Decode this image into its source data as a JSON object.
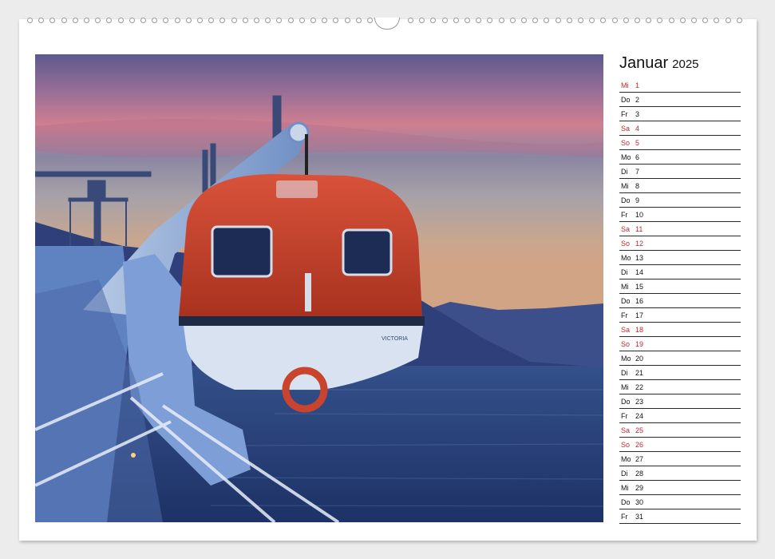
{
  "calendar": {
    "month": "Januar",
    "year": "2025",
    "weekend_color": "#c2272d",
    "days": [
      {
        "wd": "Mi",
        "d": "1",
        "red": true
      },
      {
        "wd": "Do",
        "d": "2",
        "red": false
      },
      {
        "wd": "Fr",
        "d": "3",
        "red": false
      },
      {
        "wd": "Sa",
        "d": "4",
        "red": true
      },
      {
        "wd": "So",
        "d": "5",
        "red": true
      },
      {
        "wd": "Mo",
        "d": "6",
        "red": false
      },
      {
        "wd": "Di",
        "d": "7",
        "red": false
      },
      {
        "wd": "Mi",
        "d": "8",
        "red": false
      },
      {
        "wd": "Do",
        "d": "9",
        "red": false
      },
      {
        "wd": "Fr",
        "d": "10",
        "red": false
      },
      {
        "wd": "Sa",
        "d": "11",
        "red": true
      },
      {
        "wd": "So",
        "d": "12",
        "red": true
      },
      {
        "wd": "Mo",
        "d": "13",
        "red": false
      },
      {
        "wd": "Di",
        "d": "14",
        "red": false
      },
      {
        "wd": "Mi",
        "d": "15",
        "red": false
      },
      {
        "wd": "Do",
        "d": "16",
        "red": false
      },
      {
        "wd": "Fr",
        "d": "17",
        "red": false
      },
      {
        "wd": "Sa",
        "d": "18",
        "red": true
      },
      {
        "wd": "So",
        "d": "19",
        "red": true
      },
      {
        "wd": "Mo",
        "d": "20",
        "red": false
      },
      {
        "wd": "Di",
        "d": "21",
        "red": false
      },
      {
        "wd": "Mi",
        "d": "22",
        "red": false
      },
      {
        "wd": "Do",
        "d": "23",
        "red": false
      },
      {
        "wd": "Fr",
        "d": "24",
        "red": false
      },
      {
        "wd": "Sa",
        "d": "25",
        "red": true
      },
      {
        "wd": "So",
        "d": "26",
        "red": true
      },
      {
        "wd": "Mo",
        "d": "27",
        "red": false
      },
      {
        "wd": "Di",
        "d": "28",
        "red": false
      },
      {
        "wd": "Mi",
        "d": "29",
        "red": false
      },
      {
        "wd": "Do",
        "d": "30",
        "red": false
      },
      {
        "wd": "Fr",
        "d": "31",
        "red": false
      }
    ]
  },
  "photo": {
    "boat_name": "VICTORIA",
    "sky_top": "#5e5a8c",
    "sky_pink": "#c97a8e",
    "sky_horizon": "#c9a88a",
    "sea": "#2a4378",
    "lifeboat_color": "#c8442e"
  }
}
